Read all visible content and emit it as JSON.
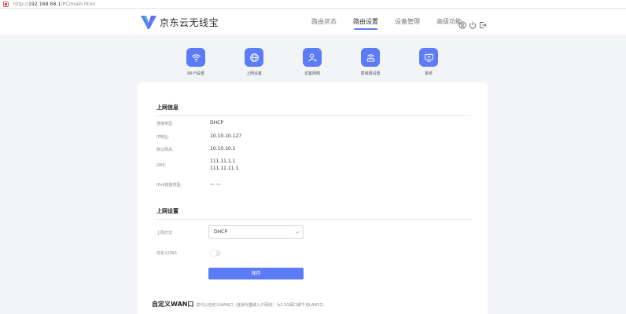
{
  "browser": {
    "url_prefix": "http://",
    "url_host": "192.168.68.1",
    "url_path": "/PC/main.html"
  },
  "header": {
    "brand": "京东云无线宝",
    "nav": [
      {
        "label": "路由状态",
        "active": false
      },
      {
        "label": "路由设置",
        "active": true
      },
      {
        "label": "设备管理",
        "active": false
      },
      {
        "label": "高级功能",
        "active": false
      }
    ],
    "icons": [
      "user-icon",
      "power-icon",
      "logout-icon"
    ]
  },
  "subnav": [
    {
      "label": "Wi-Fi设置",
      "icon": "wifi-icon"
    },
    {
      "label": "上网设置",
      "icon": "globe-icon"
    },
    {
      "label": "访客网络",
      "icon": "guest-icon"
    },
    {
      "label": "局域网设置",
      "icon": "lan-icon"
    },
    {
      "label": "系统",
      "icon": "monitor-icon"
    }
  ],
  "network_info": {
    "title": "上网信息",
    "rows": [
      {
        "label": "连接类型:",
        "value": "DHCP"
      },
      {
        "label": "IP地址:",
        "value": "10.10.10.127"
      },
      {
        "label": "默认网关:",
        "value": "10.10.10.1"
      },
      {
        "label": "DNS:",
        "value": "111.11.1.1",
        "value2": "111.11.11.1"
      },
      {
        "label": "IPv6连接类型:",
        "value": "— —"
      }
    ]
  },
  "network_settings": {
    "title": "上网设置",
    "mode_label": "上网方式",
    "mode_value": "DHCP",
    "custom_dns_label": "自定义DNS",
    "custom_dns_enabled": false,
    "save_label": "保存"
  },
  "custom_wan": {
    "title": "自定义WAN口",
    "desc": "您可以自定义WAN口（连接光猫或入户网线）为2.5G网口或千兆LAN1口"
  },
  "colors": {
    "accent": "#5b7cf5",
    "page_bg": "#f3f4f7"
  }
}
